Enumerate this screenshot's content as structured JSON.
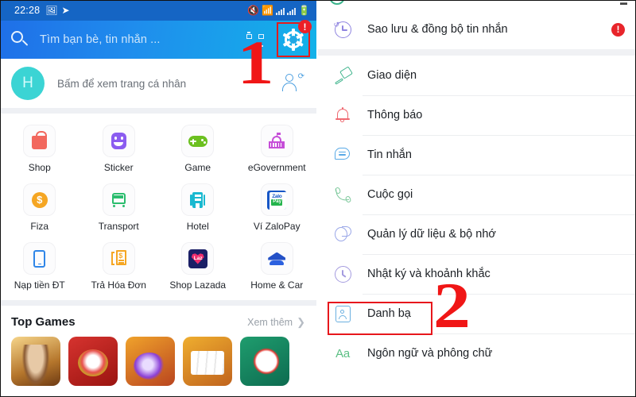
{
  "left_phone": {
    "statusbar": {
      "time": "22:28",
      "icons": [
        "image-icon",
        "telegram-send-icon",
        "mute-icon",
        "wifi-icon",
        "signal-bars-icon",
        "signal-bars-2-icon",
        "battery-icon"
      ]
    },
    "appbar": {
      "search_placeholder": "Tìm bạn bè, tin nhắn ...",
      "search_icon": "search-icon",
      "qr_icon": "qr-code-icon",
      "settings_icon": "gear-icon",
      "settings_badge": "!",
      "highlight_color": "#e51b1b"
    },
    "profile": {
      "avatar_initial": "H",
      "avatar_color": "#3bd4d4",
      "caption": "Bấm để xem trang cá nhân",
      "add_friend_icon": "add-friend-icon"
    },
    "app_grid": [
      [
        {
          "label": "Shop",
          "icon": "shopping-bag-icon",
          "color": "#f2685e"
        },
        {
          "label": "Sticker",
          "icon": "sticker-smile-icon",
          "color": "#8b5cf0"
        },
        {
          "label": "Game",
          "icon": "gamepad-icon",
          "color": "#6cc020"
        },
        {
          "label": "eGovernment",
          "icon": "government-building-icon",
          "color": "#c64fd8"
        }
      ],
      [
        {
          "label": "Fiza",
          "icon": "coin-dollar-icon",
          "color": "#f5a623"
        },
        {
          "label": "Transport",
          "icon": "bus-icon",
          "color": "#2bbd6e"
        },
        {
          "label": "Hotel",
          "icon": "hotel-building-icon",
          "color": "#19b9d0"
        },
        {
          "label": "Ví ZaloPay",
          "icon": "zalopay-wallet-icon",
          "color": "#1756c6"
        }
      ],
      [
        {
          "label": "Nạp tiền ĐT",
          "icon": "mobile-phone-icon",
          "color": "#2f86e8"
        },
        {
          "label": "Trả Hóa Đơn",
          "icon": "invoice-bill-icon",
          "color": "#f5a623"
        },
        {
          "label": "Shop Lazada",
          "icon": "lazada-heart-icon",
          "color": "#f02e6e"
        },
        {
          "label": "Home & Car",
          "icon": "home-car-icon",
          "color": "#2451c7"
        }
      ]
    ],
    "top_games": {
      "title": "Top Games",
      "more_label": "Xem thêm",
      "more_icon": "chevron-right-icon",
      "tiles": [
        "game-thumb-1",
        "game-thumb-2",
        "game-thumb-3",
        "game-thumb-4",
        "game-thumb-5"
      ]
    },
    "annotation_number": "1"
  },
  "right_settings": {
    "items": [
      {
        "label": "Sao lưu & đồng bộ tin nhắn",
        "icon": "history-clock-icon",
        "icon_color": "#8f84e0",
        "warning": "!"
      },
      {
        "label": "Giao diện",
        "icon": "paint-brush-icon",
        "icon_color": "#41b58e",
        "warning": ""
      },
      {
        "label": "Thông báo",
        "icon": "bell-icon",
        "icon_color": "#ef6a72",
        "warning": ""
      },
      {
        "label": "Tin nhắn",
        "icon": "chat-bubble-icon",
        "icon_color": "#58a9e6",
        "warning": ""
      },
      {
        "label": "Cuộc gọi",
        "icon": "phone-call-icon",
        "icon_color": "#7cc89b",
        "warning": ""
      },
      {
        "label": "Quản lý dữ liệu & bộ nhớ",
        "icon": "pie-chart-icon",
        "icon_color": "#9aa7e8",
        "warning": ""
      },
      {
        "label": "Nhật ký và khoảnh khắc",
        "icon": "clock-icon",
        "icon_color": "#a49bdf",
        "warning": ""
      },
      {
        "label": "Danh bạ",
        "icon": "contact-card-icon",
        "icon_color": "#6bb0e0",
        "warning": ""
      },
      {
        "label": "Ngôn ngữ và phông chữ",
        "icon": "font-aa-icon",
        "icon_color": "#5bbf84",
        "warning": ""
      }
    ],
    "highlighted_item": "Danh bạ",
    "highlight_color": "#e7171c",
    "annotation_number": "2"
  }
}
